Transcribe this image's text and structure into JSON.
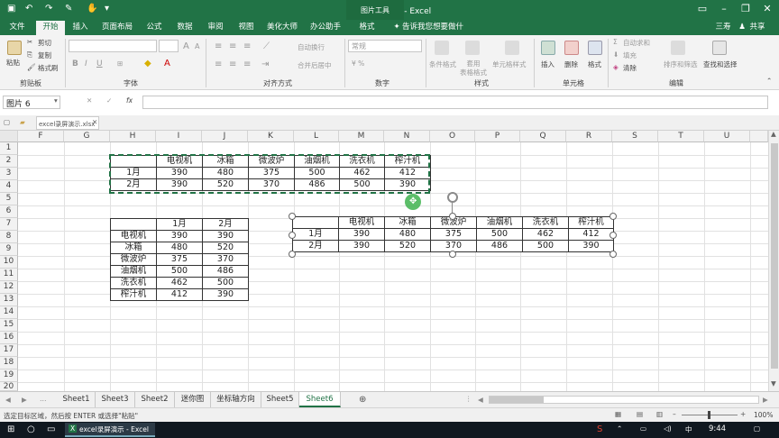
{
  "window": {
    "title": "excel录屏演示 - Excel",
    "picture_tools": "图片工具"
  },
  "ribbon_tabs": [
    "文件",
    "开始",
    "插入",
    "页面布局",
    "公式",
    "数据",
    "审阅",
    "视图",
    "美化大师",
    "办公助手",
    "格式"
  ],
  "active_tab": "开始",
  "tell_me": "告诉我您想要做什么...",
  "user": {
    "name": "三寿",
    "share": "共享"
  },
  "ribbon": {
    "clipboard": {
      "paste": "粘贴",
      "cut": "剪切",
      "copy": "复制",
      "format_painter": "格式刷",
      "group": "剪贴板"
    },
    "font": {
      "bold": "B",
      "italic": "I",
      "underline": "U",
      "group": "字体",
      "grow": "A",
      "shrink": "A"
    },
    "alignment": {
      "wrap": "自动换行",
      "merge": "合并后居中",
      "group": "对齐方式"
    },
    "number": {
      "format": "常规",
      "group": "数字"
    },
    "styles": {
      "conditional": "条件格式",
      "table": "套用\n表格格式",
      "cell_styles": "单元格样式",
      "group": "样式"
    },
    "cells": {
      "insert": "插入",
      "delete": "删除",
      "format": "格式",
      "group": "单元格"
    },
    "editing": {
      "autosum": "自动求和",
      "fill": "填充",
      "clear": "清除",
      "sort": "排序和筛选",
      "find": "查找和选择",
      "group": "编辑"
    }
  },
  "formula_bar": {
    "name_box": "图片 6",
    "fx": "fx",
    "cancel": "✕",
    "enter": "✓"
  },
  "file_tab": "excel录屏演示.xlsx",
  "columns": [
    "F",
    "G",
    "H",
    "I",
    "J",
    "K",
    "L",
    "M",
    "N",
    "O",
    "P",
    "Q",
    "R",
    "S",
    "T",
    "U"
  ],
  "rows": [
    "1",
    "2",
    "3",
    "4",
    "5",
    "6",
    "7",
    "8",
    "9",
    "10",
    "11",
    "12",
    "13",
    "14",
    "15",
    "16",
    "17",
    "18",
    "19",
    "20"
  ],
  "table_top": {
    "header": [
      "",
      "电视机",
      "冰箱",
      "微波炉",
      "油烟机",
      "洗衣机",
      "榨汁机"
    ],
    "rows": [
      [
        "1月",
        "390",
        "480",
        "375",
        "500",
        "462",
        "412"
      ],
      [
        "2月",
        "390",
        "520",
        "370",
        "486",
        "500",
        "390"
      ]
    ]
  },
  "table_left": {
    "header": [
      "",
      "1月",
      "2月"
    ],
    "rows": [
      [
        "电视机",
        "390",
        "390"
      ],
      [
        "冰箱",
        "480",
        "520"
      ],
      [
        "微波炉",
        "375",
        "370"
      ],
      [
        "油烟机",
        "500",
        "486"
      ],
      [
        "洗衣机",
        "462",
        "500"
      ],
      [
        "榨汁机",
        "412",
        "390"
      ]
    ]
  },
  "table_picture": {
    "header": [
      "",
      "电视机",
      "冰箱",
      "微波炉",
      "油烟机",
      "洗衣机",
      "榨汁机"
    ],
    "rows": [
      [
        "1月",
        "390",
        "480",
        "375",
        "500",
        "462",
        "412"
      ],
      [
        "2月",
        "390",
        "520",
        "370",
        "486",
        "500",
        "390"
      ]
    ]
  },
  "sheet_tabs": [
    "Sheet1",
    "Sheet3",
    "Sheet2",
    "迷你图",
    "坐标轴方向",
    "Sheet5",
    "Sheet6"
  ],
  "active_sheet": "Sheet6",
  "status": {
    "message": "选定目标区域，然后按 ENTER 或选择\"粘贴\"",
    "zoom": "100%"
  },
  "taskbar": {
    "app": "excel录屏演示 - Excel",
    "time": "9:44"
  },
  "colors": {
    "excel_green": "#217346",
    "selection_green": "#217346",
    "taskbar": "#101820"
  }
}
